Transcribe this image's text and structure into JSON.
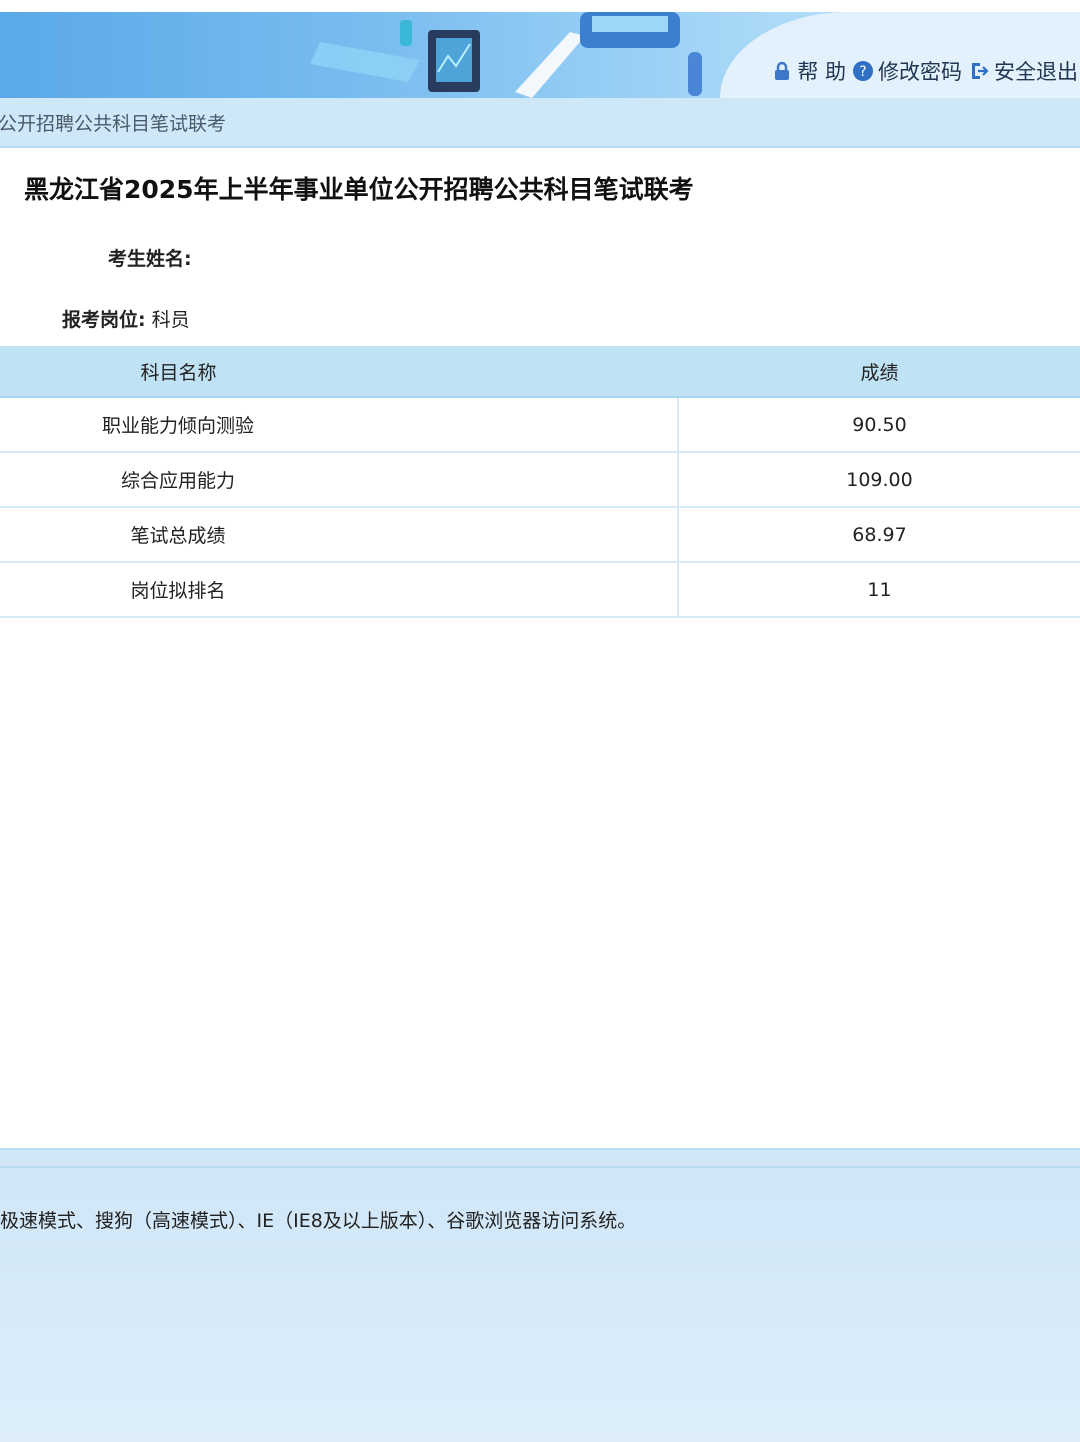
{
  "header": {
    "nav": {
      "help": "帮 助",
      "change_password": "修改密码",
      "logout": "安全退出"
    }
  },
  "breadcrumb": "公开招聘公共科目笔试联考",
  "page_title": "黑龙江省2025年上半年事业单位公开招聘公共科目笔试联考",
  "candidate": {
    "name_label": "考生姓名:",
    "name_value": "",
    "position_label": "报考岗位:",
    "position_value": "科员"
  },
  "table": {
    "headers": [
      "科目名称",
      "成绩"
    ],
    "rows": [
      {
        "subject": "职业能力倾向测验",
        "score": "90.50"
      },
      {
        "subject": "综合应用能力",
        "score": "109.00"
      },
      {
        "subject": "笔试总成绩",
        "score": "68.97"
      },
      {
        "subject": "岗位拟排名",
        "score": "11"
      }
    ]
  },
  "footer": {
    "note": "极速模式、搜狗（高速模式）、IE（IE8及以上版本）、谷歌浏览器访问系统。"
  }
}
